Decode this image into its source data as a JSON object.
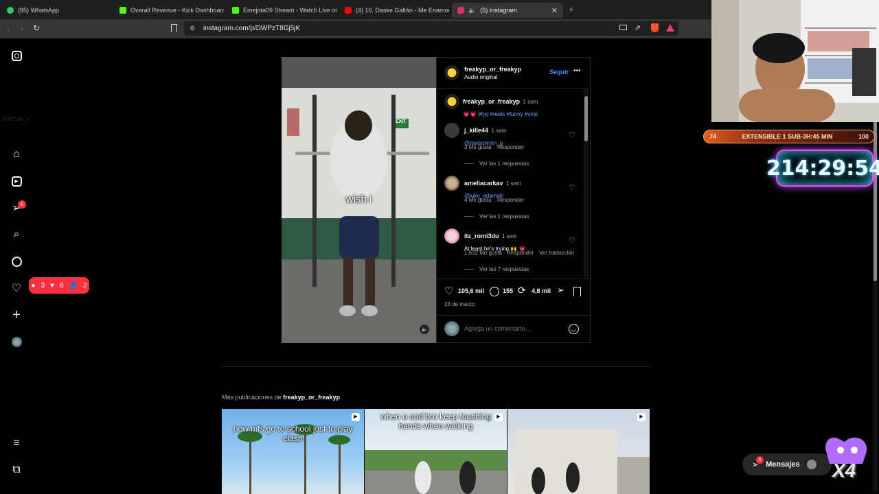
{
  "browser": {
    "tabs": [
      {
        "title": "(85) WhatsApp",
        "color": "#25d366"
      },
      {
        "title": "Overall Revenue - Kick Dashboard",
        "color": "#53fc18"
      },
      {
        "title": "Emejota09 Stream - Watch Live on K",
        "color": "#53fc18"
      },
      {
        "title": "(4) 10. Daske Galtán - Me Enamoras",
        "color": "#ff0000"
      },
      {
        "title": "(5) Instagram",
        "color": "#e1306c"
      }
    ],
    "new_tab": "+",
    "url": "instagram.com/p/DWPzT8Gj5jK"
  },
  "sidebar": {
    "notifications_badge": "6",
    "activity_popup": {
      "comments": "3",
      "likes": "6",
      "follows": "2"
    },
    "faded_text": "EMEFOR_X⁰"
  },
  "post": {
    "author": "freakyp_or_freakyp",
    "audio": "Audio original",
    "follow_label": "Seguir",
    "video_caption": "wish i",
    "exit_sign": "EXIT",
    "caption": {
      "user": "freakyp_or_freakyp",
      "time": "1 sem",
      "text": "💗💗 #fyp #reels #funny #viral"
    },
    "comments": [
      {
        "user": "j_kille44",
        "time": "1 sem",
        "text": "@maisonnnn_g",
        "likes": "3 Me gusta",
        "reply": "Responder",
        "translate": "",
        "replies": "Ver las 1 respuestas"
      },
      {
        "user": "ameliacarkav",
        "time": "1 sem",
        "text": "@luke_adamski",
        "likes": "4 Me gusta",
        "reply": "Responder",
        "translate": "",
        "replies": "Ver las 1 respuestas"
      },
      {
        "user": "itz_romi3du",
        "time": "1 sem",
        "text": "At least he's trying 🙌 💗",
        "likes": "1.632 Me gusta",
        "reply": "Responder",
        "translate": "Ver traducción",
        "replies": "Ver las 7 respuestas"
      }
    ],
    "stats": {
      "likes": "105,6 mil",
      "comments": "155",
      "reposts": "4,8 mil"
    },
    "date": "23 de marzo",
    "comment_placeholder": "Agrega un comentario..."
  },
  "more_posts": {
    "prefix": "Más publicaciones de",
    "author": "freakyp_or_freakyp",
    "thumbs": [
      {
        "caption": "how mfs go to school just to play clash"
      },
      {
        "caption": "when u and bro keep touching hands when walking"
      },
      {
        "caption": ""
      }
    ]
  },
  "messages": {
    "label": "Mensajes",
    "badge": "5"
  },
  "overlay": {
    "sub_left": "74",
    "sub_text": "EXTENSIBLE 1 SUB-3H:45 MIN",
    "sub_right": "100",
    "timer": "214:29:54",
    "multiplier": "X4"
  }
}
